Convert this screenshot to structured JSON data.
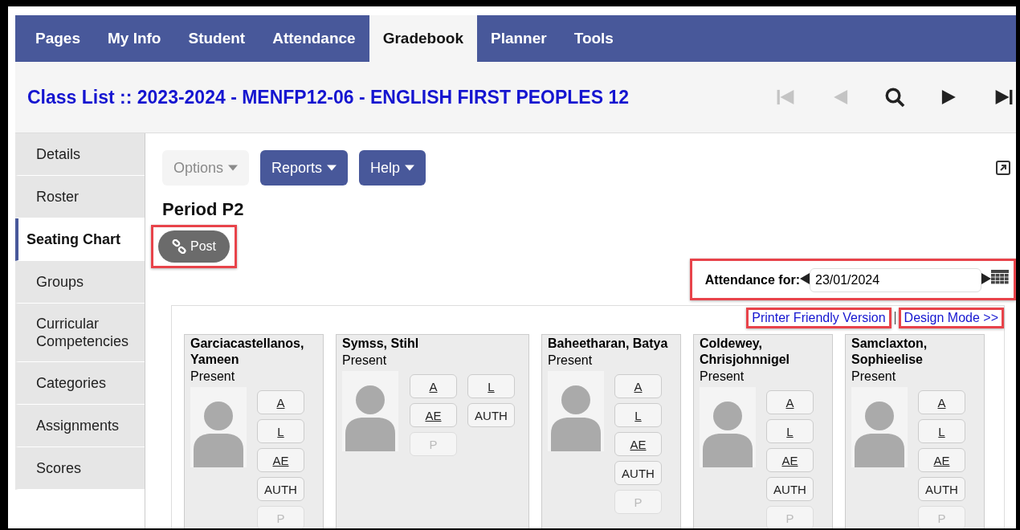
{
  "top_nav": {
    "tabs": [
      {
        "label": "Pages",
        "selected": false
      },
      {
        "label": "My Info",
        "selected": false
      },
      {
        "label": "Student",
        "selected": false
      },
      {
        "label": "Attendance",
        "selected": false
      },
      {
        "label": "Gradebook",
        "selected": true
      },
      {
        "label": "Planner",
        "selected": false
      },
      {
        "label": "Tools",
        "selected": false
      }
    ]
  },
  "header": {
    "title": "Class List :: 2023-2024 - MENFP12-06 - ENGLISH FIRST PEOPLES 12",
    "record_nav": [
      {
        "kind": "first",
        "disabled": true
      },
      {
        "kind": "previous",
        "disabled": true
      },
      {
        "kind": "search",
        "disabled": false
      },
      {
        "kind": "next",
        "disabled": false
      },
      {
        "kind": "last",
        "disabled": false
      }
    ]
  },
  "sidebar": {
    "items": [
      {
        "label": "Details",
        "selected": false
      },
      {
        "label": "Roster",
        "selected": false
      },
      {
        "label": "Seating Chart",
        "selected": true
      },
      {
        "label": "Groups",
        "selected": false
      },
      {
        "label": "Curricular Competencies",
        "selected": false
      },
      {
        "label": "Categories",
        "selected": false
      },
      {
        "label": "Assignments",
        "selected": false
      },
      {
        "label": "Scores",
        "selected": false
      }
    ]
  },
  "toolbar": {
    "buttons": [
      {
        "label": "Options",
        "disabled": true
      },
      {
        "label": "Reports",
        "disabled": false
      },
      {
        "label": "Help",
        "disabled": false
      }
    ]
  },
  "period_heading": "Period P2",
  "post_button": {
    "label": "Post",
    "highlighted": true
  },
  "attendance_date": {
    "label": "Attendance for:",
    "value": "23/01/2024",
    "highlighted": true
  },
  "chart_links": [
    {
      "label": "Printer Friendly Version",
      "highlighted": true
    },
    {
      "label": "Design Mode >>",
      "highlighted": true
    }
  ],
  "students": [
    {
      "name": "Garciacastellanos, Yameen",
      "status": "Present",
      "kind": "narrow",
      "codes": [
        {
          "label": "A",
          "underlined": true,
          "disabled": false
        },
        {
          "label": "L",
          "underlined": true,
          "disabled": false
        },
        {
          "label": "AE",
          "underlined": true,
          "disabled": false
        },
        {
          "label": "AUTH",
          "underlined": false,
          "disabled": false
        },
        {
          "label": "P",
          "underlined": false,
          "disabled": true
        }
      ]
    },
    {
      "name": "Symss, Stihl",
      "status": "Present",
      "kind": "wide",
      "codes": [
        {
          "label": "A",
          "underlined": true,
          "disabled": false
        },
        {
          "label": "L",
          "underlined": true,
          "disabled": false
        },
        {
          "label": "AE",
          "underlined": true,
          "disabled": false
        },
        {
          "label": "AUTH",
          "underlined": false,
          "disabled": false
        },
        {
          "label": "P",
          "underlined": false,
          "disabled": true
        }
      ]
    },
    {
      "name": "Baheetharan, Batya",
      "status": "Present",
      "kind": "narrow",
      "codes": [
        {
          "label": "A",
          "underlined": true,
          "disabled": false
        },
        {
          "label": "L",
          "underlined": true,
          "disabled": false
        },
        {
          "label": "AE",
          "underlined": true,
          "disabled": false
        },
        {
          "label": "AUTH",
          "underlined": false,
          "disabled": false
        },
        {
          "label": "P",
          "underlined": false,
          "disabled": true
        }
      ]
    },
    {
      "name": "Coldewey, Chrisjohnnigel",
      "status": "Present",
      "kind": "narrow",
      "codes": [
        {
          "label": "A",
          "underlined": true,
          "disabled": false
        },
        {
          "label": "L",
          "underlined": true,
          "disabled": false
        },
        {
          "label": "AE",
          "underlined": true,
          "disabled": false
        },
        {
          "label": "AUTH",
          "underlined": false,
          "disabled": false
        },
        {
          "label": "P",
          "underlined": false,
          "disabled": true
        }
      ]
    },
    {
      "name": "Samclaxton, Sophieelise",
      "status": "Present",
      "kind": "narrow",
      "codes": [
        {
          "label": "A",
          "underlined": true,
          "disabled": false
        },
        {
          "label": "L",
          "underlined": true,
          "disabled": false
        },
        {
          "label": "AE",
          "underlined": true,
          "disabled": false
        },
        {
          "label": "AUTH",
          "underlined": false,
          "disabled": false
        },
        {
          "label": "P",
          "underlined": false,
          "disabled": true
        }
      ]
    }
  ]
}
